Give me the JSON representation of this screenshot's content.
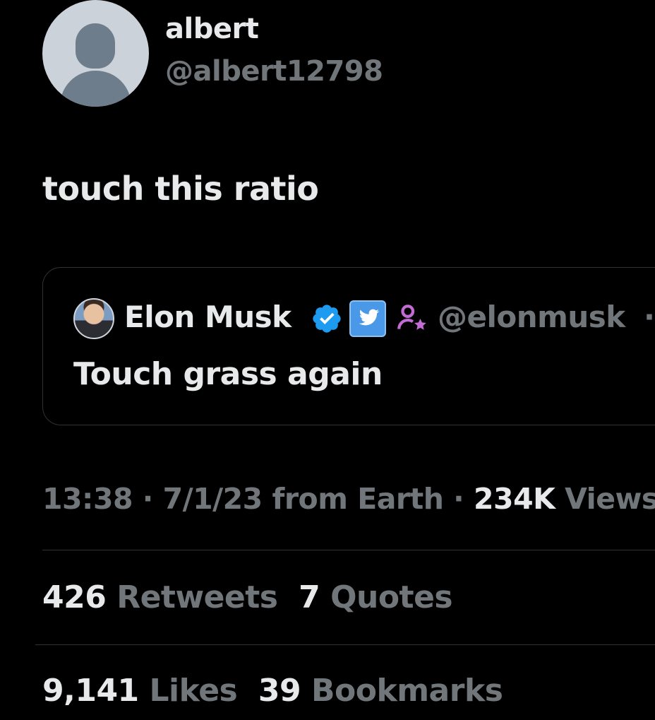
{
  "author": {
    "display_name": "albert",
    "handle": "@albert12798"
  },
  "tweet": {
    "text": "touch this ratio"
  },
  "quoted_tweet": {
    "display_name": "Elon Musk",
    "handle": "@elonmusk",
    "separator": "·",
    "text": "Touch grass again",
    "badges": [
      "verified-icon",
      "twitter-bird-icon",
      "affiliate-icon"
    ]
  },
  "meta": {
    "time": "13:38",
    "dot1": " · ",
    "date_location": "7/1/23 from Earth",
    "dot2": " · ",
    "views_count": "234K",
    "views_label": "Views"
  },
  "stats": {
    "retweets_count": "426",
    "retweets_label": "Retweets",
    "quotes_count": "7",
    "quotes_label": "Quotes",
    "likes_count": "9,141",
    "likes_label": "Likes",
    "bookmarks_count": "39",
    "bookmarks_label": "Bookmarks"
  },
  "colors": {
    "background": "#000000",
    "text_primary": "#e7e9ea",
    "text_secondary": "#71767b",
    "verified_blue": "#1d9bf0",
    "affiliate_purple": "#c56bd6"
  }
}
